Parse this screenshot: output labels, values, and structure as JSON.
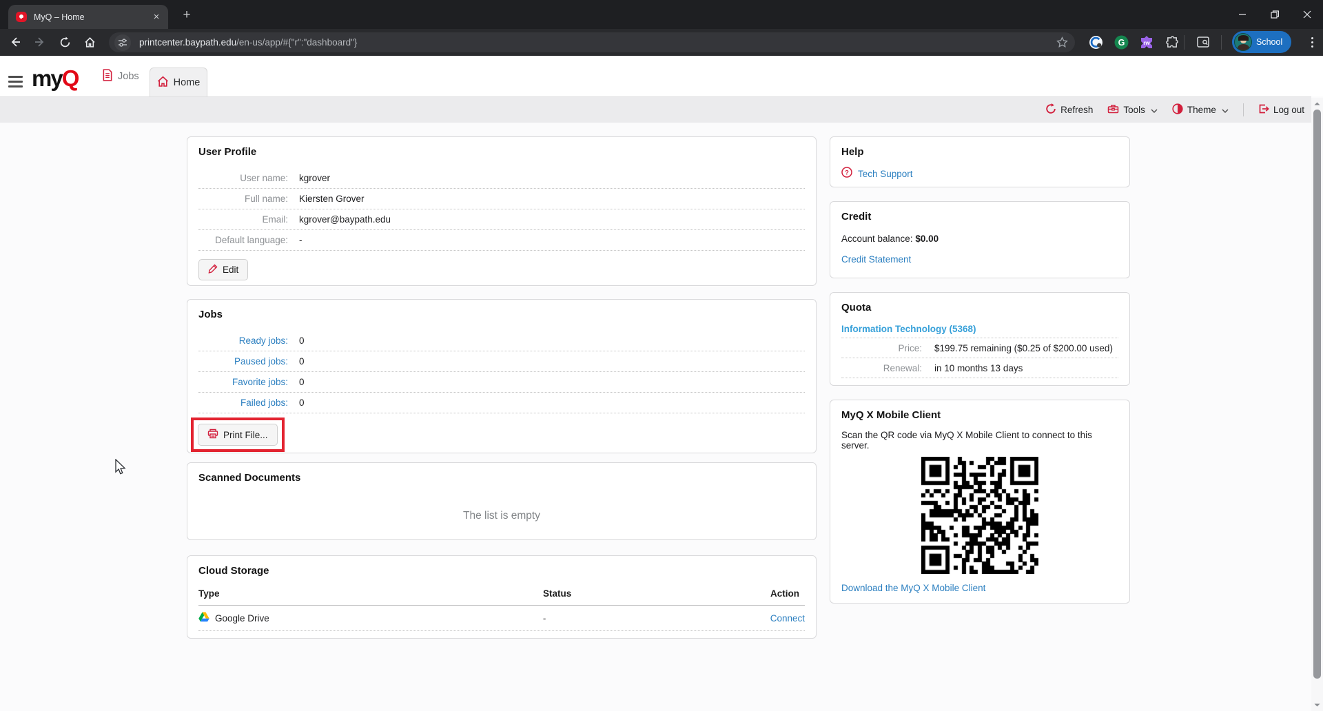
{
  "browser": {
    "tab_title": "MyQ – Home",
    "tab_close_glyph": "×",
    "new_tab_glyph": "+",
    "url_domain": "printcenter.baypath.edu",
    "url_path": "/en-us/app/#{\"r\":\"dashboard\"}",
    "profile_label": "School",
    "extension_rw_label": "rw",
    "extension_grammarly_label": "G"
  },
  "nav": {
    "brand_my": "my",
    "brand_q": "Q",
    "jobs_tab": "Jobs",
    "home_tab": "Home"
  },
  "toolbar": {
    "refresh": "Refresh",
    "tools": "Tools",
    "theme": "Theme",
    "logout": "Log out"
  },
  "profile_card": {
    "title": "User Profile",
    "rows": [
      {
        "label": "User name:",
        "value": "kgrover"
      },
      {
        "label": "Full name:",
        "value": "Kiersten Grover"
      },
      {
        "label": "Email:",
        "value": "kgrover@baypath.edu"
      },
      {
        "label": "Default language:",
        "value": "-"
      }
    ],
    "edit_label": "Edit"
  },
  "jobs_card": {
    "title": "Jobs",
    "rows": [
      {
        "label": "Ready jobs:",
        "value": "0"
      },
      {
        "label": "Paused jobs:",
        "value": "0"
      },
      {
        "label": "Favorite jobs:",
        "value": "0"
      },
      {
        "label": "Failed jobs:",
        "value": "0"
      }
    ],
    "print_label": "Print File..."
  },
  "scanned_card": {
    "title": "Scanned Documents",
    "empty_message": "The list is empty"
  },
  "cloud_card": {
    "title": "Cloud Storage",
    "headers": [
      "Type",
      "Status",
      "Action"
    ],
    "row": {
      "type": "Google Drive",
      "status": "-",
      "action": "Connect"
    }
  },
  "help_card": {
    "title": "Help",
    "link": "Tech Support"
  },
  "credit_card": {
    "title": "Credit",
    "balance_label": "Account balance: ",
    "balance_value": "$0.00",
    "link": "Credit Statement"
  },
  "quota_card": {
    "title": "Quota",
    "link": "Information Technology (5368)",
    "rows": [
      {
        "label": "Price:",
        "value": "$199.75 remaining ($0.25 of $200.00 used)"
      },
      {
        "label": "Renewal:",
        "value": "in 10 months 13 days"
      }
    ]
  },
  "mobile_card": {
    "title": "MyQ X Mobile Client",
    "description": "Scan the QR code via MyQ X Mobile Client to connect to this server.",
    "link": "Download the MyQ X Mobile Client"
  },
  "icons": {
    "favicon": "myq-red-speech-bubble",
    "refresh": "circular-arrow",
    "tools": "toolbox",
    "theme": "half-filled-circle",
    "logout": "door-exit-arrow",
    "edit": "pencil",
    "print": "printer",
    "help": "question-circle",
    "cloud_type": "google-drive-triangle",
    "jobs_tab": "document",
    "home_tab": "house"
  },
  "colors": {
    "brand_red": "#e20917",
    "icon_red": "#d21f3c",
    "link_blue": "#2b7fc0",
    "quota_link_blue": "#36a0d9",
    "annotation_red": "#e32330",
    "profile_pill_blue": "#1d6fc0"
  }
}
